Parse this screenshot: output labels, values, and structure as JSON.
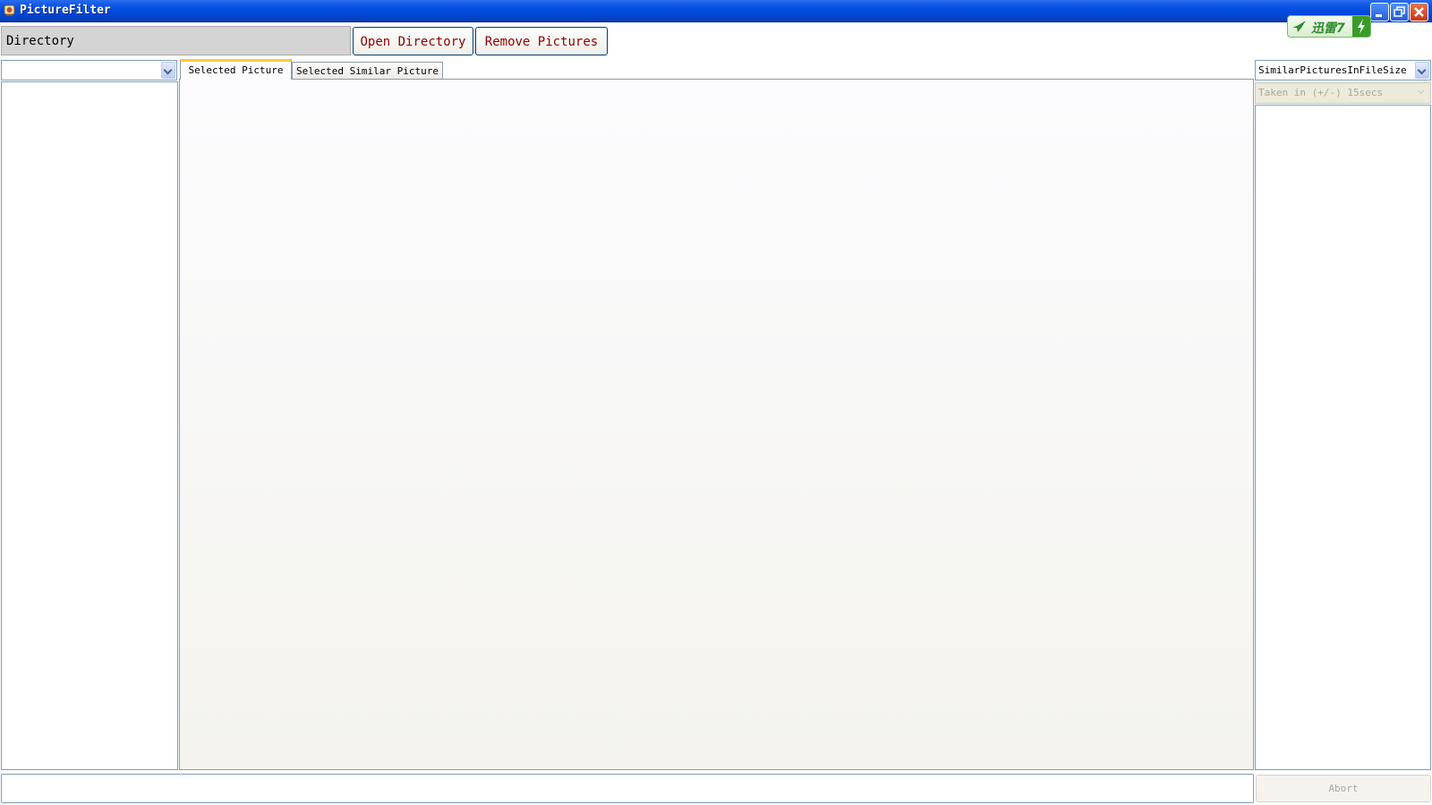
{
  "window": {
    "title": "PictureFilter"
  },
  "toolbar": {
    "directory_label": "Directory",
    "open_directory": "Open Directory",
    "remove_pictures": "Remove Pictures"
  },
  "xunlei_badge": {
    "text": "迅雷7"
  },
  "left_panel": {
    "combo_value": ""
  },
  "tabs": [
    {
      "label": "Selected Picture",
      "selected": true
    },
    {
      "label": "Selected Similar Picture",
      "selected": false
    }
  ],
  "right_panel": {
    "filter_mode": "SimilarPicturesInFileSize",
    "time_range": "Taken in (+/-) 15secs"
  },
  "bottom": {
    "abort_label": "Abort"
  },
  "colors": {
    "titlebar": "#0a53e3",
    "button_text": "#8b0000",
    "tab_accent": "#ffc83c"
  }
}
